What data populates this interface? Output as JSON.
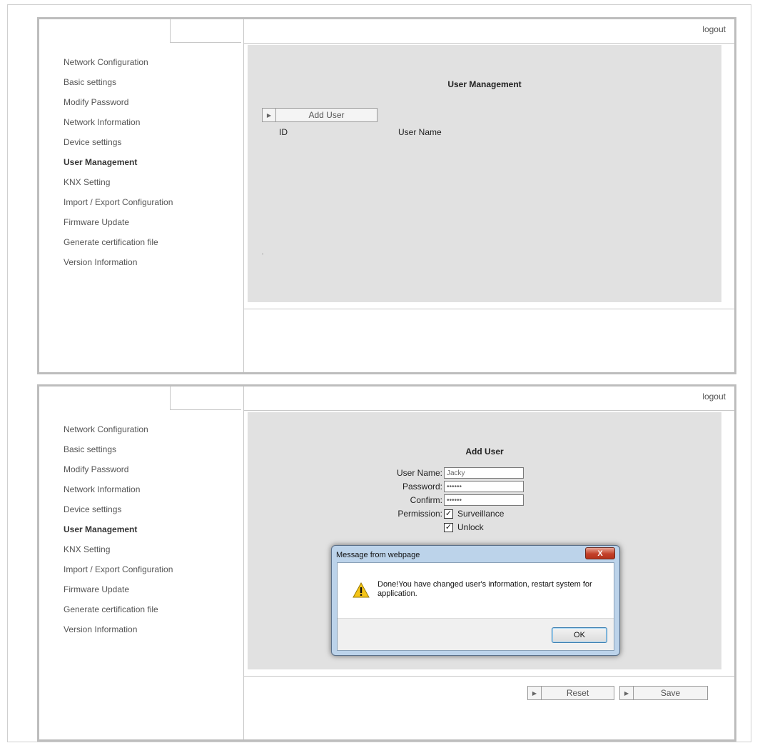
{
  "logout_label": "logout",
  "nav_items": [
    {
      "label": "Network Configuration"
    },
    {
      "label": "Basic settings"
    },
    {
      "label": "Modify Password"
    },
    {
      "label": "Network Information"
    },
    {
      "label": "Device settings"
    },
    {
      "label": "User Management",
      "active": true
    },
    {
      "label": "KNX Setting"
    },
    {
      "label": "Import / Export Configuration"
    },
    {
      "label": "Firmware Update"
    },
    {
      "label": "Generate certification file"
    },
    {
      "label": "Version Information"
    }
  ],
  "user_management": {
    "title": "User Management",
    "add_user_button": "Add User",
    "columns": {
      "id": "ID",
      "user_name": "User Name"
    }
  },
  "add_user": {
    "title": "Add User",
    "user_name_label": "User Name:",
    "user_name_value": "Jacky",
    "password_label": "Password:",
    "password_value": "••••••",
    "confirm_label": "Confirm:",
    "confirm_value": "••••••",
    "permission_label": "Permission:",
    "permissions": [
      {
        "label": "Surveillance",
        "checked": true
      },
      {
        "label": "Unlock",
        "checked": true
      }
    ],
    "reset_button": "Reset",
    "save_button": "Save"
  },
  "dialog": {
    "title": "Message from webpage",
    "close_label": "X",
    "message": "Done!You have changed user's information, restart system for application.",
    "ok_button": "OK"
  },
  "colors": {
    "content_bg": "#e1e1e1",
    "panel_border": "#bdbdbd",
    "dialog_frame": "#bcd3ea",
    "close_red": "#c3412a",
    "warning_yellow": "#f5c518"
  }
}
